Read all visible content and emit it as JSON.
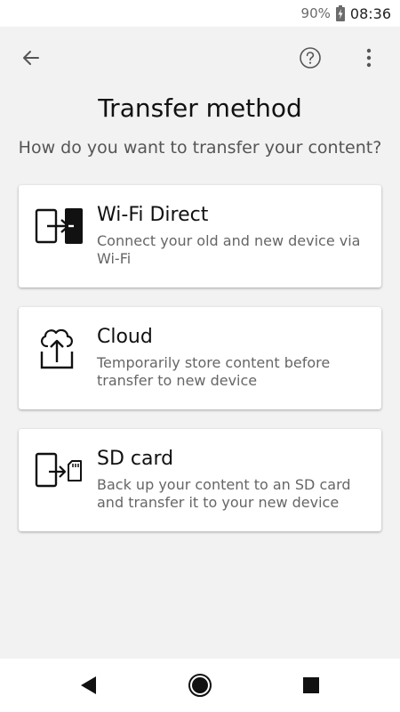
{
  "status_bar": {
    "battery_percent": "90%",
    "time": "08:36",
    "icons": [
      "battery-charging-icon"
    ]
  },
  "app_bar": {
    "icons": [
      "arrow-left-icon",
      "help-circle-icon",
      "more-vertical-icon"
    ]
  },
  "header": {
    "title": "Transfer method",
    "subtitle": "How do you want to transfer your content?"
  },
  "options": [
    {
      "title": "Wi-Fi Direct",
      "description": "Connect your old and new device via Wi-Fi",
      "icon": "wifi-direct-transfer-icon"
    },
    {
      "title": "Cloud",
      "description": "Temporarily store content before transfer to new device",
      "icon": "cloud-upload-icon"
    },
    {
      "title": "SD card",
      "description": "Back up your content to an SD card and transfer it to your new device",
      "icon": "sd-card-transfer-icon"
    }
  ],
  "nav_bar": {
    "icons": [
      "nav-back-icon",
      "nav-home-icon",
      "nav-recent-icon"
    ]
  },
  "colors": {
    "background": "#f2f2f2",
    "card": "#ffffff",
    "text_primary": "#111111",
    "text_secondary": "#666666"
  }
}
